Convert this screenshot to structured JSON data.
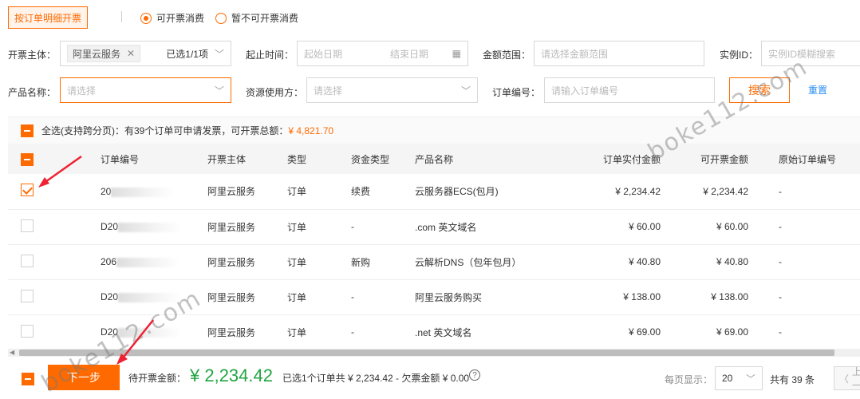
{
  "top": {
    "order_detail_button": "按订单明细开票",
    "radio_invoiceable": "可开票消费",
    "radio_not_invoiceable": "暂不可开票消费"
  },
  "filters": {
    "subject_label": "开票主体：",
    "subject_tag": "阿里云服务",
    "subject_selected": "已选1/1项",
    "start_label": "起止时间：",
    "start_placeholder": "起始日期",
    "end_placeholder": "结束日期",
    "amount_label": "金额范围：",
    "amount_placeholder": "请选择金额范围",
    "instance_label": "实例ID：",
    "instance_placeholder": "实例ID模糊搜索",
    "product_label": "产品名称：",
    "product_placeholder": "请选择",
    "resource_label": "资源使用方：",
    "resource_placeholder": "请选择",
    "order_no_label": "订单编号：",
    "order_no_placeholder": "请输入订单编号",
    "search_button": "搜索",
    "reset_link": "重置"
  },
  "summary": {
    "text": "全选(支持跨分页)：有39个订单可申请发票，可开票总额：",
    "total": "¥ 4,821.70"
  },
  "table": {
    "headers": [
      "订单编号",
      "开票主体",
      "类型",
      "资金类型",
      "产品名称",
      "订单实付金额",
      "可开票金额",
      "原始订单编号"
    ],
    "rows": [
      {
        "order_no": "20",
        "subject": "阿里云服务",
        "type": "订单",
        "fund": "续费",
        "product": "云服务器ECS(包月)",
        "paid": "¥ 2,234.42",
        "invoiceable": "¥ 2,234.42",
        "orig": "-",
        "checked": true
      },
      {
        "order_no": "D20",
        "subject": "阿里云服务",
        "type": "订单",
        "fund": "-",
        "product": ".com 英文域名",
        "paid": "¥ 60.00",
        "invoiceable": "¥ 60.00",
        "orig": "-",
        "checked": false
      },
      {
        "order_no": "206",
        "subject": "阿里云服务",
        "type": "订单",
        "fund": "新购",
        "product": "云解析DNS（包年包月）",
        "paid": "¥ 40.80",
        "invoiceable": "¥ 40.80",
        "orig": "-",
        "checked": false
      },
      {
        "order_no": "D20",
        "subject": "阿里云服务",
        "type": "订单",
        "fund": "-",
        "product": "阿里云服务购买",
        "paid": "¥ 138.00",
        "invoiceable": "¥ 138.00",
        "orig": "-",
        "checked": false
      },
      {
        "order_no": "D20",
        "subject": "阿里云服务",
        "type": "订单",
        "fund": "-",
        "product": ".net 英文域名",
        "paid": "¥ 69.00",
        "invoiceable": "¥ 69.00",
        "orig": "-",
        "checked": false
      }
    ]
  },
  "footer": {
    "next_button": "下一步",
    "pending_label": "待开票金额：",
    "pending_amount": "¥ 2,234.42",
    "selected_text": "已选1个订单共 ¥ 2,234.42 - 欠票金额 ¥ 0.00",
    "page_size_label": "每页显示：",
    "page_size": "20",
    "total_count": "共有 39 条",
    "prev_button": "上一"
  },
  "watermark": "boke112.com",
  "colors": {
    "accent": "#ff6a00",
    "link": "#2a8df0",
    "success": "#22a543"
  }
}
